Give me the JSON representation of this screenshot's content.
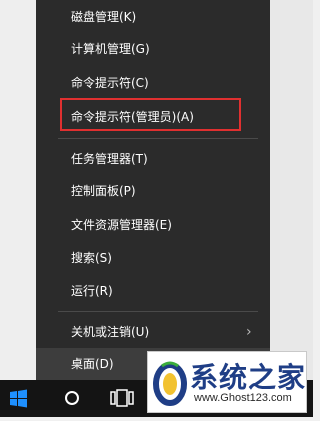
{
  "menu": {
    "items": [
      {
        "label": "磁盘管理(K)"
      },
      {
        "label": "计算机管理(G)"
      },
      {
        "label": "命令提示符(C)"
      },
      {
        "label": "命令提示符(管理员)(A)"
      },
      {
        "label": "任务管理器(T)"
      },
      {
        "label": "控制面板(P)"
      },
      {
        "label": "文件资源管理器(E)"
      },
      {
        "label": "搜索(S)"
      },
      {
        "label": "运行(R)"
      },
      {
        "label": "关机或注销(U)"
      },
      {
        "label": "桌面(D)"
      }
    ],
    "submenu_arrow": "›",
    "highlight_color": "#e03030"
  },
  "watermark": {
    "title": "系统之家",
    "url": "www.Ghost123.com"
  },
  "taskbar": {
    "icons": [
      "windows-start-icon",
      "cortana-circle-icon",
      "task-view-icon"
    ]
  }
}
